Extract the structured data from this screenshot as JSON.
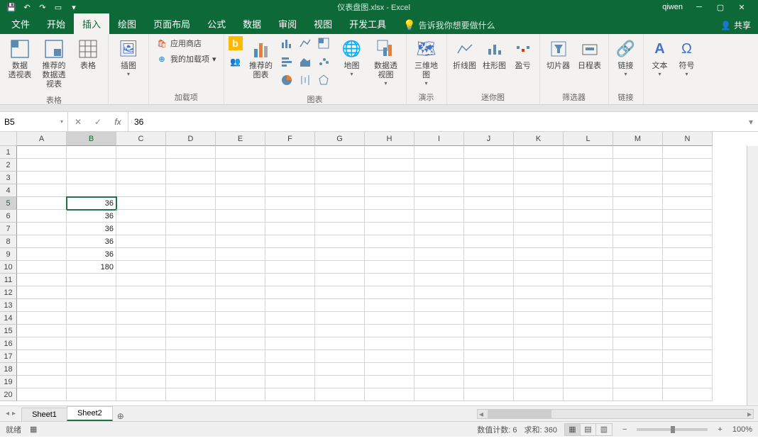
{
  "titlebar": {
    "filename": "仪表盘图.xlsx - Excel",
    "user": "qiwen",
    "share_label": "共享"
  },
  "menu": {
    "tabs": [
      "文件",
      "开始",
      "插入",
      "绘图",
      "页面布局",
      "公式",
      "数据",
      "审阅",
      "视图",
      "开发工具"
    ],
    "active_index": 2,
    "tell_me": "告诉我你想要做什么"
  },
  "ribbon": {
    "groups": {
      "tables": {
        "label": "表格",
        "pivot_table": "数据\n透视表",
        "recommended_pivot": "推荐的\n数据透视表",
        "table": "表格"
      },
      "illustrations": {
        "label": "",
        "pic": "插图"
      },
      "addins": {
        "label": "加载项",
        "store": "应用商店",
        "my_addins": "我的加载项"
      },
      "charts": {
        "label": "图表",
        "bing": "",
        "recommended": "推荐的\n图表",
        "map": "地图",
        "pivot_chart": "数据透视图"
      },
      "demo": {
        "label": "演示",
        "3dmap": "三维地\n图"
      },
      "sparklines": {
        "label": "迷你图",
        "line": "折线图",
        "column": "柱形图",
        "winloss": "盈亏"
      },
      "filters": {
        "label": "筛选器",
        "slicer": "切片器",
        "timeline": "日程表"
      },
      "links": {
        "label": "链接",
        "link": "链接"
      },
      "text": {
        "text": "文本"
      },
      "symbols": {
        "symbol": "符号"
      }
    }
  },
  "formula": {
    "name_box": "B5",
    "value": "36"
  },
  "grid": {
    "columns": [
      "A",
      "B",
      "C",
      "D",
      "E",
      "F",
      "G",
      "H",
      "I",
      "J",
      "K",
      "L",
      "M",
      "N"
    ],
    "rows": [
      1,
      2,
      3,
      4,
      5,
      6,
      7,
      8,
      9,
      10,
      11,
      12,
      13,
      14,
      15,
      16,
      17,
      18,
      19,
      20
    ],
    "selected_col": "B",
    "selected_row": 5,
    "data": {
      "B5": "36",
      "B6": "36",
      "B7": "36",
      "B8": "36",
      "B9": "36",
      "B10": "180"
    }
  },
  "sheets": {
    "tabs": [
      "Sheet1",
      "Sheet2"
    ],
    "active_index": 1
  },
  "status": {
    "ready": "就绪",
    "count_label": "数值计数:",
    "count": "6",
    "sum_label": "求和:",
    "sum": "360",
    "zoom": "100%"
  }
}
